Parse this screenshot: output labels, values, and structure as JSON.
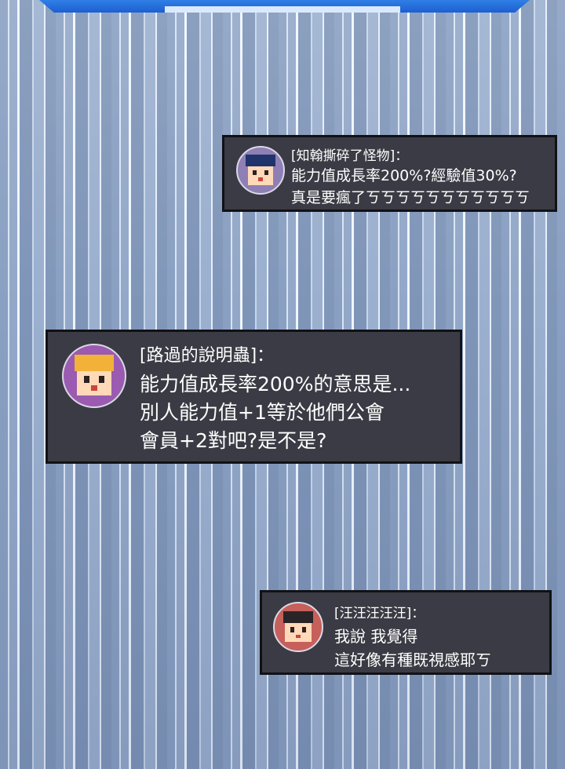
{
  "messages": [
    {
      "speaker": "[知翰撕碎了怪物]：",
      "lines": [
        "能力值成長率200%?經驗值30%?",
        "真是要瘋了ㄎㄎㄎㄎㄎㄎㄎㄎㄎㄎㄎ"
      ],
      "avatar_colors": {
        "ring": "#8f7fb5",
        "hair": "#20336b"
      }
    },
    {
      "speaker": "[路過的說明蟲]：",
      "lines": [
        "能力值成長率200%的意思是...",
        "別人能力值+1等於他們公會",
        "會員+2對吧?是不是?"
      ],
      "avatar_colors": {
        "ring": "#9b5bb0",
        "hair": "#f2b23a"
      }
    },
    {
      "speaker": "[汪汪汪汪汪]：",
      "lines": [
        "我說 我覺得",
        "這好像有種既視感耶ㄎ"
      ],
      "avatar_colors": {
        "ring": "#c75f5a",
        "hair": "#2a2426"
      }
    }
  ]
}
